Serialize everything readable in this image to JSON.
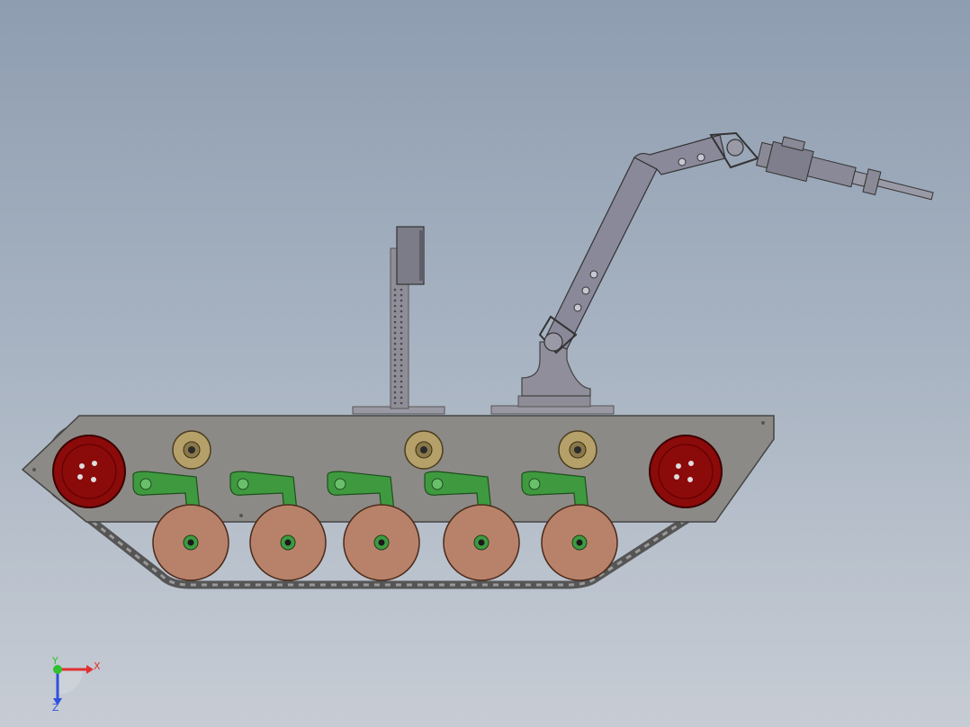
{
  "viewport": {
    "background_top": "#8e9db0",
    "background_bottom": "#c7ccd4"
  },
  "model": {
    "hull_color": "#8c8a86",
    "sprocket_color": "#8b0a0a",
    "idler_color": "#b5a06a",
    "road_wheel_color": "#b8826a",
    "suspension_arm_color": "#3f9a3f",
    "track_color": "#6b6b6b",
    "arm_color": "#8a8a9a"
  },
  "triad": {
    "x_label": "X",
    "y_label": "Y",
    "z_label": "Z",
    "x_color": "#e03030",
    "y_color": "#30c030",
    "z_color": "#3050e0"
  }
}
